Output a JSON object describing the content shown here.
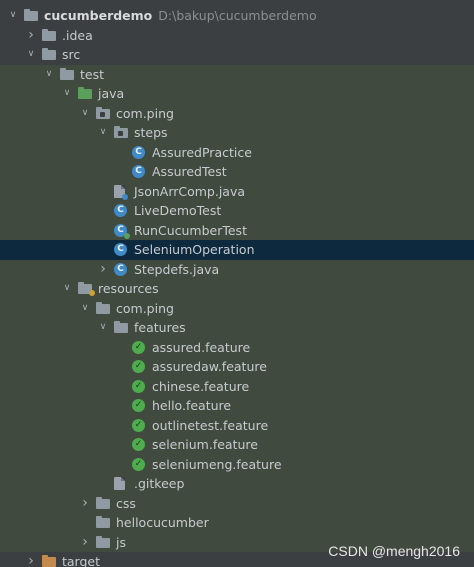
{
  "rows": [
    {
      "label": "cucumberdemo",
      "path": "D:\\bakup\\cucumberdemo",
      "icon": "module-folder-icon",
      "expanded": true,
      "depth": 0
    },
    {
      "label": ".idea",
      "icon": "folder-icon",
      "expanded": false,
      "depth": 1
    },
    {
      "label": "src",
      "icon": "folder-icon",
      "expanded": true,
      "depth": 1
    },
    {
      "label": "test",
      "icon": "folder-icon",
      "expanded": true,
      "depth": 2
    },
    {
      "label": "java",
      "icon": "test-source-folder-icon",
      "expanded": true,
      "depth": 3
    },
    {
      "label": "com.ping",
      "icon": "package-icon",
      "expanded": true,
      "depth": 4
    },
    {
      "label": "steps",
      "icon": "package-icon",
      "expanded": true,
      "depth": 5
    },
    {
      "label": "AssuredPractice",
      "icon": "java-class-icon",
      "depth": 6
    },
    {
      "label": "AssuredTest",
      "icon": "java-class-icon",
      "depth": 6
    },
    {
      "label": "JsonArrComp.java",
      "icon": "java-file-icon",
      "depth": 5
    },
    {
      "label": "LiveDemoTest",
      "icon": "java-class-icon",
      "depth": 5
    },
    {
      "label": "RunCucumberTest",
      "icon": "test-class-icon",
      "depth": 5
    },
    {
      "label": "SeleniumOperation",
      "icon": "java-class-icon",
      "depth": 5,
      "selected": true
    },
    {
      "label": "Stepdefs.java",
      "icon": "java-class-icon",
      "expanded": false,
      "depth": 5
    },
    {
      "label": "resources",
      "icon": "resources-folder-icon",
      "expanded": true,
      "depth": 3
    },
    {
      "label": "com.ping",
      "icon": "folder-icon",
      "expanded": true,
      "depth": 4
    },
    {
      "label": "features",
      "icon": "folder-icon",
      "expanded": true,
      "depth": 5
    },
    {
      "label": "assured.feature",
      "icon": "feature-file-icon",
      "depth": 6
    },
    {
      "label": "assuredaw.feature",
      "icon": "feature-file-icon",
      "depth": 6
    },
    {
      "label": "chinese.feature",
      "icon": "feature-file-icon",
      "depth": 6
    },
    {
      "label": "hello.feature",
      "icon": "feature-file-icon",
      "depth": 6
    },
    {
      "label": "outlinetest.feature",
      "icon": "feature-file-icon",
      "depth": 6
    },
    {
      "label": "selenium.feature",
      "icon": "feature-file-icon",
      "depth": 6
    },
    {
      "label": "seleniumeng.feature",
      "icon": "feature-file-icon",
      "depth": 6
    },
    {
      "label": ".gitkeep",
      "icon": "text-file-icon",
      "depth": 5
    },
    {
      "label": "css",
      "icon": "folder-icon",
      "expanded": false,
      "depth": 4
    },
    {
      "label": "hellocucumber",
      "icon": "folder-icon",
      "depth": 4
    },
    {
      "label": "js",
      "icon": "folder-icon",
      "expanded": false,
      "depth": 4
    },
    {
      "label": "target",
      "icon": "excluded-folder-icon",
      "expanded": false,
      "depth": 1
    }
  ],
  "watermark": "CSDN @mengh2016",
  "colors": {
    "background": "#3c3f41",
    "test_area": "#414a3e",
    "selection": "#0d293e",
    "class_icon": "#3f8ac7",
    "feature_icon": "#4eab4e",
    "test_folder": "#5aa05a"
  }
}
